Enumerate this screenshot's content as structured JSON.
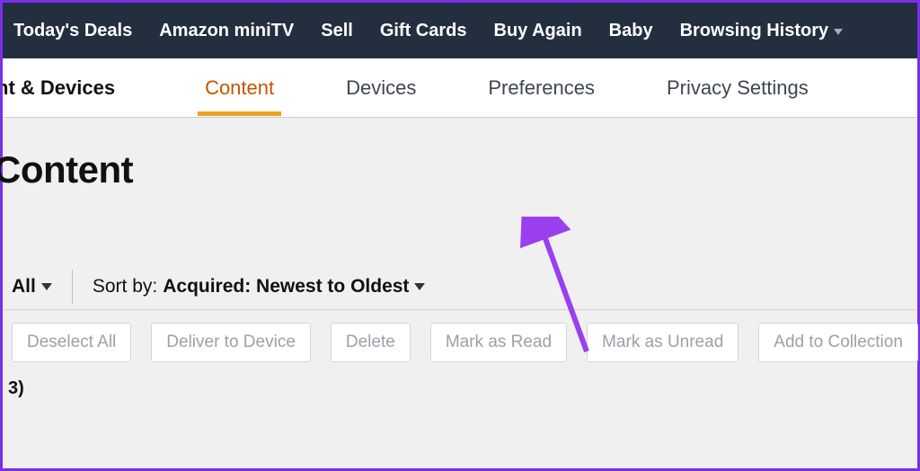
{
  "topnav": {
    "items": [
      {
        "label": "Today's Deals"
      },
      {
        "label": "Amazon miniTV"
      },
      {
        "label": "Sell"
      },
      {
        "label": "Gift Cards"
      },
      {
        "label": "Buy Again"
      },
      {
        "label": "Baby"
      },
      {
        "label": "Browsing History",
        "dropdown": true
      }
    ]
  },
  "subnav": {
    "section": "ntent & Devices",
    "tabs": [
      {
        "label": "Content",
        "active": true
      },
      {
        "label": "Devices"
      },
      {
        "label": "Preferences"
      },
      {
        "label": "Privacy Settings"
      }
    ]
  },
  "page": {
    "title": "Content"
  },
  "sort": {
    "filter_label": "All",
    "sortby_label": "Sort by: ",
    "sortby_value": "Acquired: Newest to Oldest"
  },
  "actions": [
    "Deselect All",
    "Deliver to Device",
    "Delete",
    "Mark as Read",
    "Mark as Unread",
    "Add to Collection"
  ],
  "count_fragment": "3)"
}
